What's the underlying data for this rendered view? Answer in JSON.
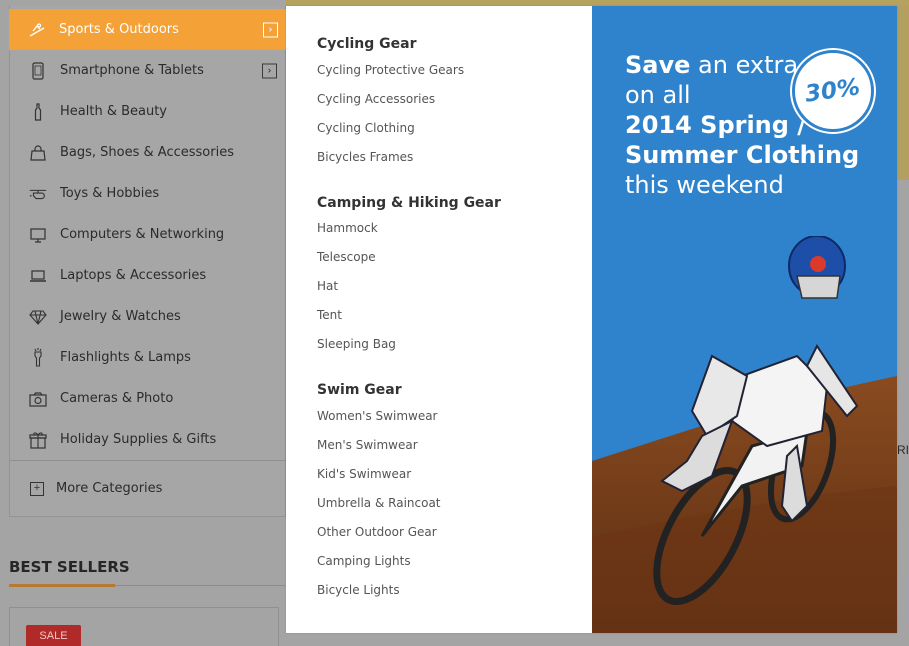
{
  "sidebar": {
    "items": [
      {
        "label": "Sports & Outdoors",
        "icon": "skier-icon",
        "active": true,
        "has_submenu": true
      },
      {
        "label": "Smartphone & Tablets",
        "icon": "smartphone-icon",
        "active": false,
        "has_submenu": true
      },
      {
        "label": "Health & Beauty",
        "icon": "bottle-icon",
        "active": false,
        "has_submenu": false
      },
      {
        "label": "Bags, Shoes & Accessories",
        "icon": "bag-icon",
        "active": false,
        "has_submenu": false
      },
      {
        "label": "Toys & Hobbies",
        "icon": "helicopter-icon",
        "active": false,
        "has_submenu": false
      },
      {
        "label": "Computers & Networking",
        "icon": "monitor-icon",
        "active": false,
        "has_submenu": false
      },
      {
        "label": "Laptops & Accessories",
        "icon": "laptop-icon",
        "active": false,
        "has_submenu": false
      },
      {
        "label": "Jewelry & Watches",
        "icon": "diamond-icon",
        "active": false,
        "has_submenu": false
      },
      {
        "label": "Flashlights & Lamps",
        "icon": "flashlight-icon",
        "active": false,
        "has_submenu": false
      },
      {
        "label": "Cameras & Photo",
        "icon": "camera-icon",
        "active": false,
        "has_submenu": false
      },
      {
        "label": "Holiday Supplies & Gifts",
        "icon": "gift-icon",
        "active": false,
        "has_submenu": false
      }
    ],
    "more_label": "More Categories"
  },
  "best_sellers": {
    "title": "BEST SELLERS",
    "sale_label": "SALE"
  },
  "background": {
    "partial_text": "RI"
  },
  "mega_menu": {
    "groups": [
      {
        "title": "Cycling Gear",
        "links": [
          "Cycling Protective Gears",
          "Cycling Accessories",
          "Cycling Clothing",
          "Bicycles Frames"
        ]
      },
      {
        "title": "Camping & Hiking Gear",
        "links": [
          "Hammock",
          "Telescope",
          "Hat",
          "Tent",
          "Sleeping Bag"
        ]
      },
      {
        "title": "Swim Gear",
        "links": [
          "Women's Swimwear",
          "Men's Swimwear",
          "Kid's Swimwear",
          "Umbrella & Raincoat",
          "Other Outdoor Gear",
          "Camping Lights",
          "Bicycle Lights"
        ]
      }
    ]
  },
  "banner": {
    "line1_bold": "Save",
    "line1_rest": " an extra",
    "line2": "on all",
    "line3": "2014 Spring /",
    "line4": "Summer Clothing",
    "line5": "this weekend",
    "badge": "30%",
    "accent_color": "#2f83cc"
  },
  "colors": {
    "active_item": "#f4a137",
    "sale_badge": "#b02a2a"
  }
}
